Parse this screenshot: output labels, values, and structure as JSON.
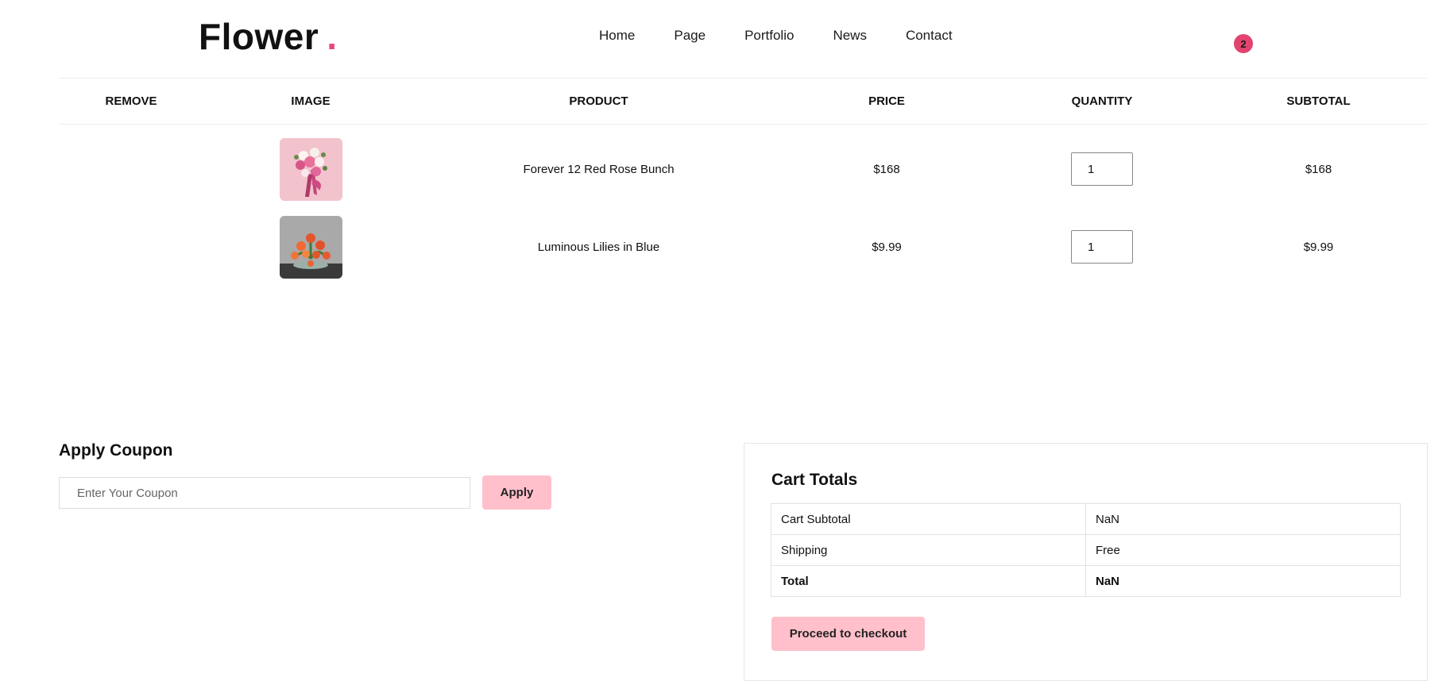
{
  "header": {
    "logo_text": "Flower",
    "logo_dot": ".",
    "nav": [
      "Home",
      "Page",
      "Portfolio",
      "News",
      "Contact"
    ],
    "cart_count": "2"
  },
  "cart": {
    "columns": {
      "remove": "REMOVE",
      "image": "IMAGE",
      "product": "PRODUCT",
      "price": "PRICE",
      "quantity": "QUANTITY",
      "subtotal": "SUBTOTAL"
    },
    "items": [
      {
        "product": "Forever 12 Red Rose Bunch",
        "price": "$168",
        "quantity": "1",
        "subtotal": "$168",
        "image_icon": "rose-bouquet-image"
      },
      {
        "product": "Luminous Lilies in Blue",
        "price": "$9.99",
        "quantity": "1",
        "subtotal": "$9.99",
        "image_icon": "lilies-arrangement-image"
      }
    ]
  },
  "coupon": {
    "title": "Apply Coupon",
    "placeholder": "Enter Your Coupon",
    "apply_label": "Apply"
  },
  "totals": {
    "title": "Cart Totals",
    "rows": [
      {
        "label": "Cart Subtotal",
        "value": "NaN"
      },
      {
        "label": "Shipping",
        "value": "Free"
      },
      {
        "label": "Total",
        "value": "NaN"
      }
    ],
    "checkout_label": "Proceed to checkout"
  },
  "colors": {
    "accent": "#e2436f",
    "button": "#ffc0cb"
  }
}
